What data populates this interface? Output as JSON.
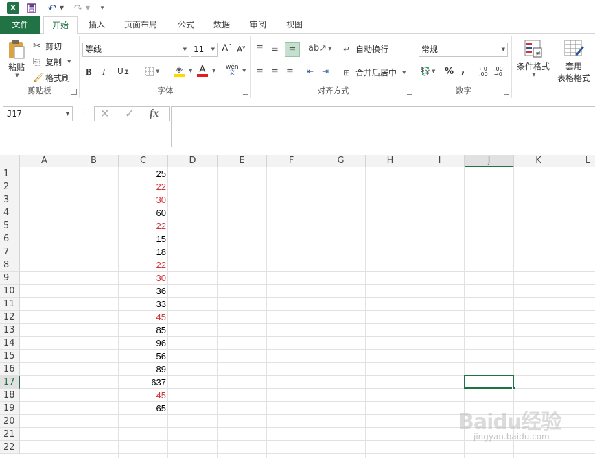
{
  "qat": {
    "logo_text": "X",
    "icons": [
      "excel-logo-icon",
      "save-icon",
      "undo-icon",
      "redo-icon",
      "customize-icon"
    ]
  },
  "tabs": [
    {
      "label": "文件",
      "name": "tab-file"
    },
    {
      "label": "开始",
      "name": "tab-home"
    },
    {
      "label": "插入",
      "name": "tab-insert"
    },
    {
      "label": "页面布局",
      "name": "tab-page-layout"
    },
    {
      "label": "公式",
      "name": "tab-formulas"
    },
    {
      "label": "数据",
      "name": "tab-data"
    },
    {
      "label": "审阅",
      "name": "tab-review"
    },
    {
      "label": "视图",
      "name": "tab-view"
    }
  ],
  "ribbon": {
    "clipboard": {
      "paste": "粘贴",
      "cut": "剪切",
      "copy": "复制",
      "format_painter": "格式刷",
      "label": "剪贴板"
    },
    "font": {
      "font_name": "等线",
      "font_size": "11",
      "label": "字体"
    },
    "alignment": {
      "wrap_text": "自动换行",
      "merge_center": "合并后居中",
      "label": "对齐方式"
    },
    "number": {
      "format": "常规",
      "label": "数字"
    },
    "styles": {
      "conditional": "条件格式",
      "table_line1": "套用",
      "table_line2": "表格格式"
    }
  },
  "formula_bar": {
    "name_box": "J17",
    "fx": "fx",
    "content": ""
  },
  "grid": {
    "columns": [
      "A",
      "B",
      "C",
      "D",
      "E",
      "F",
      "G",
      "H",
      "I",
      "J",
      "K",
      "L"
    ],
    "rows": [
      "1",
      "2",
      "3",
      "4",
      "5",
      "6",
      "7",
      "8",
      "9",
      "10",
      "11",
      "12",
      "13",
      "14",
      "15",
      "16",
      "17",
      "18",
      "19",
      "20",
      "21",
      "22"
    ],
    "selected_column": "J",
    "selected_row": "17",
    "column_c_values": [
      {
        "row": "1",
        "value": "25",
        "color": "#000000"
      },
      {
        "row": "2",
        "value": "22",
        "color": "#d13438"
      },
      {
        "row": "3",
        "value": "30",
        "color": "#d13438"
      },
      {
        "row": "4",
        "value": "60",
        "color": "#000000"
      },
      {
        "row": "5",
        "value": "22",
        "color": "#d13438"
      },
      {
        "row": "6",
        "value": "15",
        "color": "#000000"
      },
      {
        "row": "7",
        "value": "18",
        "color": "#000000"
      },
      {
        "row": "8",
        "value": "22",
        "color": "#d13438"
      },
      {
        "row": "9",
        "value": "30",
        "color": "#d13438"
      },
      {
        "row": "10",
        "value": "36",
        "color": "#000000"
      },
      {
        "row": "11",
        "value": "33",
        "color": "#000000"
      },
      {
        "row": "12",
        "value": "45",
        "color": "#d13438"
      },
      {
        "row": "13",
        "value": "85",
        "color": "#000000"
      },
      {
        "row": "14",
        "value": "96",
        "color": "#000000"
      },
      {
        "row": "15",
        "value": "56",
        "color": "#000000"
      },
      {
        "row": "16",
        "value": "89",
        "color": "#000000"
      },
      {
        "row": "17",
        "value": "637",
        "color": "#000000"
      },
      {
        "row": "18",
        "value": "45",
        "color": "#d13438"
      },
      {
        "row": "19",
        "value": "65",
        "color": "#000000"
      }
    ]
  },
  "watermark": {
    "brand": "Baidu经验",
    "url": "jingyan.baidu.com"
  },
  "colors": {
    "accent": "#217346",
    "highlight_red": "#d13438"
  }
}
